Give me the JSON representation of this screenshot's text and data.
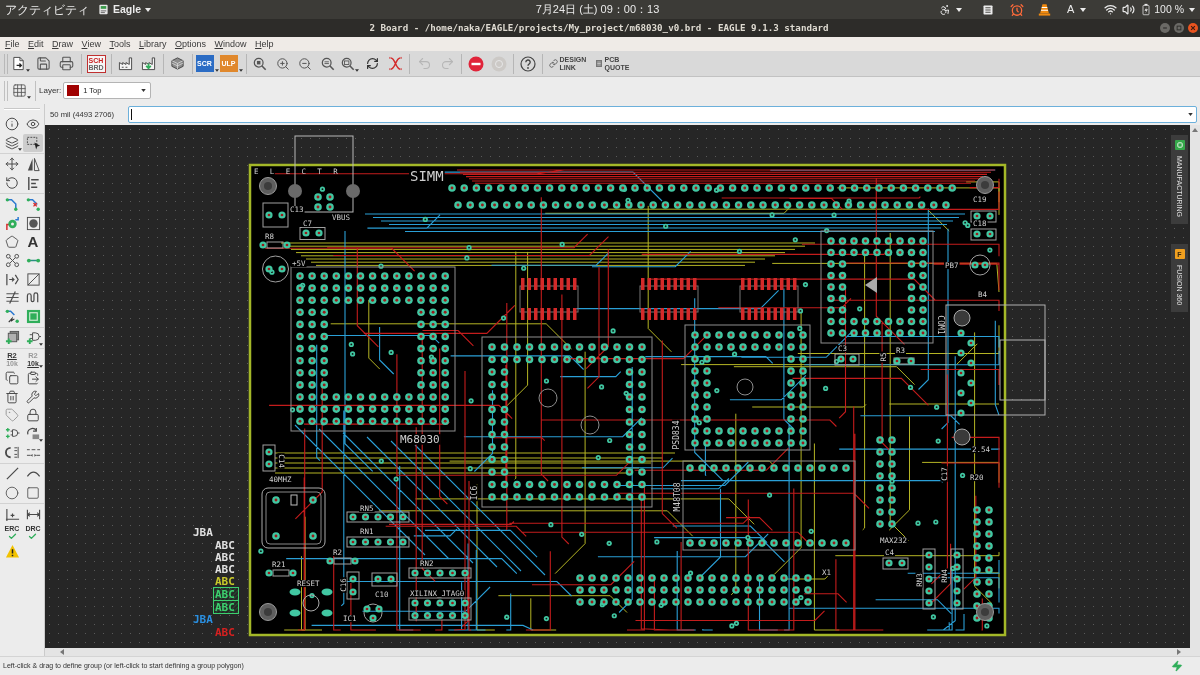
{
  "system_bar": {
    "activities": "アクティビティ",
    "app_menu": "Eagle",
    "clock": "7月24日 (土) 09：00：13",
    "keyboard_layout": "A",
    "battery": "100 %"
  },
  "window": {
    "title": "2 Board - /home/naka/EAGLE/projects/My_project/m68030_v0.brd - EAGLE 9.1.3 standard"
  },
  "menu": [
    "File",
    "Edit",
    "Draw",
    "View",
    "Tools",
    "Library",
    "Options",
    "Window",
    "Help"
  ],
  "toolbar": [
    [
      {
        "kind": "new",
        "disabled": false
      },
      {
        "kind": "save",
        "disabled": false
      },
      {
        "kind": "print",
        "disabled": false
      }
    ],
    [
      {
        "kind": "sch_brd",
        "label": "SCH",
        "sublabel": "BRD",
        "disabled": false
      }
    ],
    [
      {
        "kind": "cam",
        "disabled": false
      },
      {
        "kind": "cam_export",
        "disabled": false
      }
    ],
    [
      {
        "kind": "board_3d",
        "disabled": false
      }
    ],
    [
      {
        "kind": "script",
        "label": "SCR",
        "disabled": false
      },
      {
        "kind": "ulp",
        "label": "ULP",
        "disabled": false
      }
    ],
    [
      {
        "kind": "zoom_fit",
        "disabled": false
      },
      {
        "kind": "zoom_in",
        "disabled": false
      },
      {
        "kind": "zoom_out",
        "disabled": false
      },
      {
        "kind": "zoom_select",
        "disabled": false
      },
      {
        "kind": "zoom_last",
        "disabled": false
      },
      {
        "kind": "redraw",
        "disabled": false
      },
      {
        "kind": "ratsnest",
        "disabled": false
      }
    ],
    [
      {
        "kind": "undo",
        "disabled": true
      },
      {
        "kind": "redo",
        "disabled": true
      }
    ],
    [
      {
        "kind": "stop",
        "disabled": false
      },
      {
        "kind": "go",
        "disabled": true
      }
    ],
    [
      {
        "kind": "help",
        "disabled": false
      }
    ],
    [
      {
        "kind": "design_link",
        "label": "DESIGN LINK",
        "disabled": false
      },
      {
        "kind": "pcb_quote",
        "label": "PCB QUOTE",
        "disabled": false
      }
    ]
  ],
  "layer_bar": {
    "label": "Layer:",
    "layer": {
      "name": "1 Top",
      "color": "#a00000"
    }
  },
  "command_line": {
    "coordinates": "50 mil (4493 2706)"
  },
  "tool_palette": [
    [
      {
        "kind": "info",
        "selected": false
      },
      {
        "kind": "eye",
        "selected": false
      },
      {
        "kind": "layers",
        "selected": false
      },
      {
        "kind": "group",
        "selected": true
      }
    ],
    [
      {
        "kind": "move",
        "selected": false
      },
      {
        "kind": "mirror",
        "selected": false
      },
      {
        "kind": "rotate",
        "selected": false
      },
      {
        "kind": "align",
        "selected": false
      }
    ],
    [
      {
        "kind": "route",
        "selected": false
      },
      {
        "kind": "ripup",
        "selected": false
      },
      {
        "kind": "via",
        "selected": false
      },
      {
        "kind": "hole",
        "selected": false
      },
      {
        "kind": "polygon",
        "selected": false
      },
      {
        "kind": "text",
        "label": "A",
        "selected": false
      },
      {
        "kind": "signal",
        "selected": false
      },
      {
        "kind": "wire",
        "selected": false
      },
      {
        "kind": "miter",
        "selected": false
      },
      {
        "kind": "split",
        "selected": false
      },
      {
        "kind": "slice",
        "selected": false
      },
      {
        "kind": "meander",
        "selected": false
      },
      {
        "kind": "autorouter",
        "selected": false
      },
      {
        "kind": "optimize",
        "selected": false
      }
    ],
    [
      {
        "kind": "add",
        "selected": false
      },
      {
        "kind": "replace",
        "selected": false
      }
    ],
    [
      {
        "kind": "name",
        "label": "R2",
        "sublabel": "10k",
        "selected": false
      },
      {
        "kind": "value",
        "label": "R2",
        "sublabel": "10k",
        "selected": false
      },
      {
        "kind": "copy",
        "selected": false
      },
      {
        "kind": "paste",
        "selected": false
      },
      {
        "kind": "delete",
        "selected": false
      },
      {
        "kind": "wrench",
        "selected": false
      },
      {
        "kind": "smash",
        "selected": false
      },
      {
        "kind": "lock",
        "selected": false
      },
      {
        "kind": "gateswap",
        "selected": false
      },
      {
        "kind": "change",
        "selected": false
      },
      {
        "kind": "pinswap",
        "selected": false
      },
      {
        "kind": "splitwire",
        "selected": false
      }
    ],
    [
      {
        "kind": "line",
        "selected": false
      },
      {
        "kind": "arc",
        "selected": false
      },
      {
        "kind": "circle",
        "selected": false
      },
      {
        "kind": "rect",
        "selected": false
      }
    ],
    [
      {
        "kind": "dimension",
        "selected": false
      },
      {
        "kind": "measure",
        "selected": false
      },
      {
        "kind": "erc",
        "label": "ERC",
        "selected": false
      },
      {
        "kind": "drc",
        "label": "DRC",
        "selected": false
      },
      {
        "kind": "warning",
        "selected": false
      }
    ]
  ],
  "board": {
    "labels": [
      "E L E C T R",
      "SIMM",
      "C19",
      "C13",
      "C7",
      "VBUS",
      "C18",
      "R8",
      "+5V",
      "PB7",
      "B4",
      "COM1",
      "C3",
      "R5",
      "R3",
      "M68030",
      "PSD834",
      "2.54",
      "C14",
      "40MHZ",
      "C17",
      "R20",
      "IC6",
      "RN5",
      "M48T08",
      "RN1",
      "MAX232",
      "R2",
      "C4",
      "R21",
      "RN2",
      "X1",
      "RESET",
      "C16",
      "RN3",
      "RN4",
      "C10",
      "XILINX_JTAG0",
      "IC1"
    ],
    "legend": [
      {
        "text": "JBA",
        "color": "#e0e0e0",
        "kind": "plain"
      },
      {
        "text": "ABC",
        "color": "#e0e0e0",
        "kind": "plain"
      },
      {
        "text": "ABC",
        "color": "#e0e0e0",
        "kind": "plain"
      },
      {
        "text": "ABC",
        "color": "#e0e0e0",
        "kind": "plain"
      },
      {
        "text": "ABC",
        "color": "#c8c82a",
        "kind": "plain"
      },
      {
        "text": "ABC",
        "color": "#3ccf6e",
        "kind": "hatched"
      },
      {
        "text": "ABC",
        "color": "#3ccf6e",
        "kind": "hatched"
      },
      {
        "text": "JBA",
        "color": "#2a8fe0",
        "kind": "plain"
      },
      {
        "text": "ABC",
        "color": "#d42020",
        "kind": "plain"
      }
    ]
  },
  "side_tabs": [
    {
      "kind": "manufacturing",
      "label": "MANUFACTURING"
    },
    {
      "kind": "fusion",
      "label": "FUSION 360",
      "badge": "F"
    }
  ],
  "status_bar": {
    "message": "Left-click & drag to define group (or left-click to start defining a group polygon)"
  }
}
